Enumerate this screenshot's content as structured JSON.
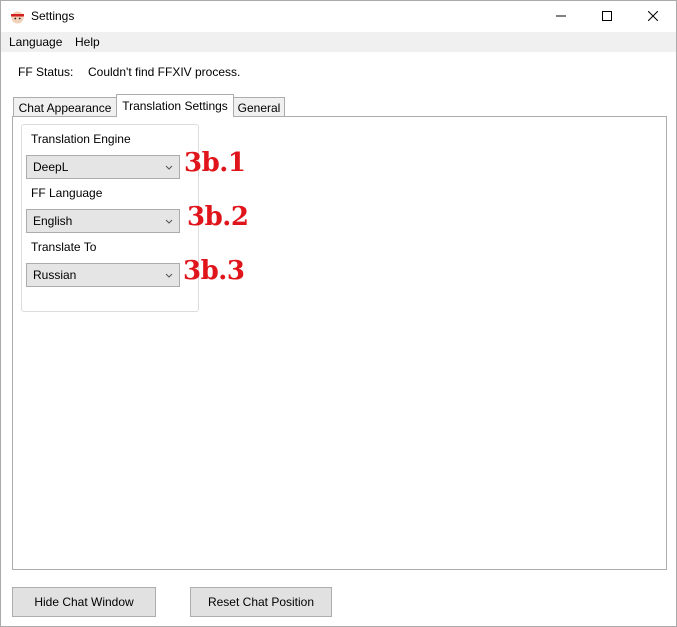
{
  "window": {
    "title": "Settings",
    "icon": "app-icon",
    "controls": [
      "minimize-icon",
      "maximize-icon",
      "close-icon"
    ]
  },
  "menu": {
    "items": [
      {
        "label": "Language"
      },
      {
        "label": "Help"
      }
    ]
  },
  "status": {
    "label": "FF Status:",
    "value": "Couldn't find FFXIV process."
  },
  "tabs": [
    {
      "label": "Chat Appearance",
      "selected": false
    },
    {
      "label": "Translation Settings",
      "selected": true
    },
    {
      "label": "General",
      "selected": false
    }
  ],
  "translation": {
    "engine": {
      "label": "Translation Engine",
      "value": "DeepL"
    },
    "ff_language": {
      "label": "FF Language",
      "value": "English"
    },
    "translate_to": {
      "label": "Translate To",
      "value": "Russian"
    }
  },
  "annotations": [
    "3b.1",
    "3b.2",
    "3b.3"
  ],
  "buttons": {
    "hide_chat": "Hide Chat Window",
    "reset_chat": "Reset Chat Position"
  },
  "colors": {
    "annotation": "#e0141b",
    "menu_bg": "#f0f0f0",
    "combo_bg": "#e5e5e5",
    "button_bg": "#e1e1e1"
  }
}
